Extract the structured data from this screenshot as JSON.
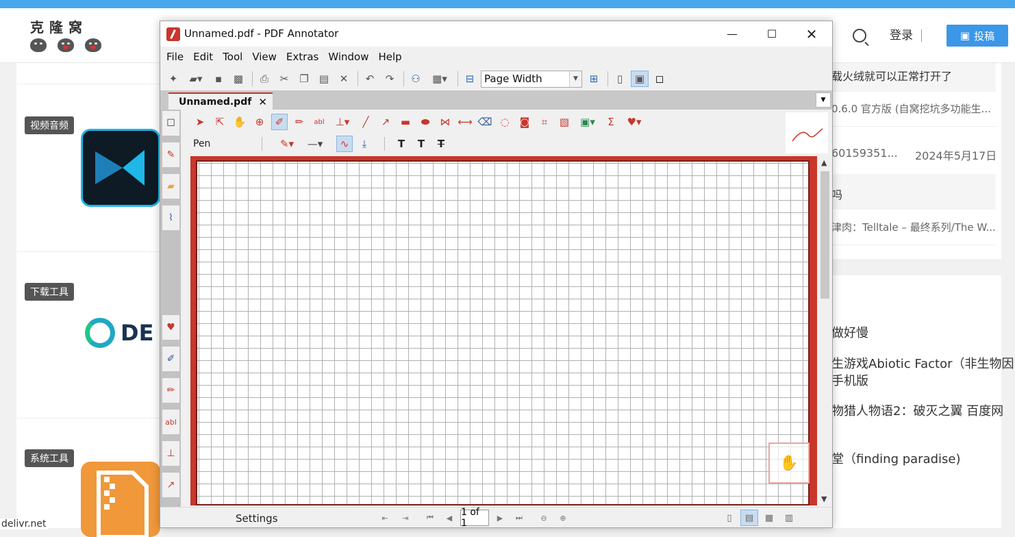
{
  "site": {
    "logo_text": "克隆窝",
    "login": "登录",
    "post_button": "投稿",
    "categories": [
      "视频音频",
      "下载工具",
      "系统工具"
    ],
    "footer_host": "delivr.net",
    "right_items": [
      "载火绒就可以正常打开了",
      "0.6.0 官方版 (自窝挖坑多功能生...",
      "60159351...",
      "2024年5月17日",
      "吗",
      "津肉：Telltale – 最终系列/The W...",
      "做好慢",
      "生游戏Abiotic Factor（非生物因",
      "手机版",
      "物猎人物语2：破灭之翼 百度网",
      "堂（finding paradise)"
    ],
    "de_logo": "DE"
  },
  "app": {
    "title": "Unnamed.pdf - PDF Annotator",
    "menu": [
      "File",
      "Edit",
      "Tool",
      "View",
      "Extras",
      "Window",
      "Help"
    ],
    "zoom": "Page Width",
    "tab": "Unnamed.pdf",
    "tool_label": "Pen",
    "status": {
      "settings": "Settings",
      "page": "1 of 1"
    },
    "colors": {
      "accent": "#c8362c",
      "selection": "#c8dcf0"
    }
  }
}
